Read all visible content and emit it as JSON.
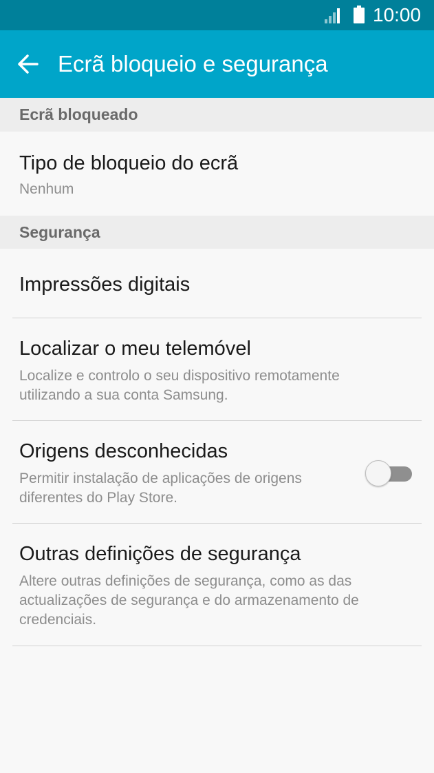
{
  "status_bar": {
    "time": "10:00",
    "icons": [
      "signal-icon",
      "battery-icon"
    ]
  },
  "app_bar": {
    "title": "Ecrã bloqueio e segurança",
    "back_icon": "arrow-left-icon"
  },
  "sections": [
    {
      "header": "Ecrã bloqueado",
      "items": [
        {
          "title": "Tipo de bloqueio do ecrã",
          "subtitle": "Nenhum"
        }
      ]
    },
    {
      "header": "Segurança",
      "items": [
        {
          "title": "Impressões digitais"
        },
        {
          "title": "Localizar o meu telemóvel",
          "subtitle": "Localize e controlo o seu dispositivo remotamente utilizando a sua conta Samsung."
        },
        {
          "title": "Origens desconhecidas",
          "subtitle": "Permitir instalação de aplicações de origens diferentes do Play Store.",
          "toggle_on": false
        },
        {
          "title": "Outras definições de segurança",
          "subtitle": "Altere outras definições de segurança, como as das actualizações de segurança e do armazenamento de credenciais."
        }
      ]
    }
  ],
  "colors": {
    "status_bar": "#00809a",
    "app_bar": "#00a5c9",
    "background": "#f8f8f8",
    "section_header_bg": "#ededed"
  }
}
